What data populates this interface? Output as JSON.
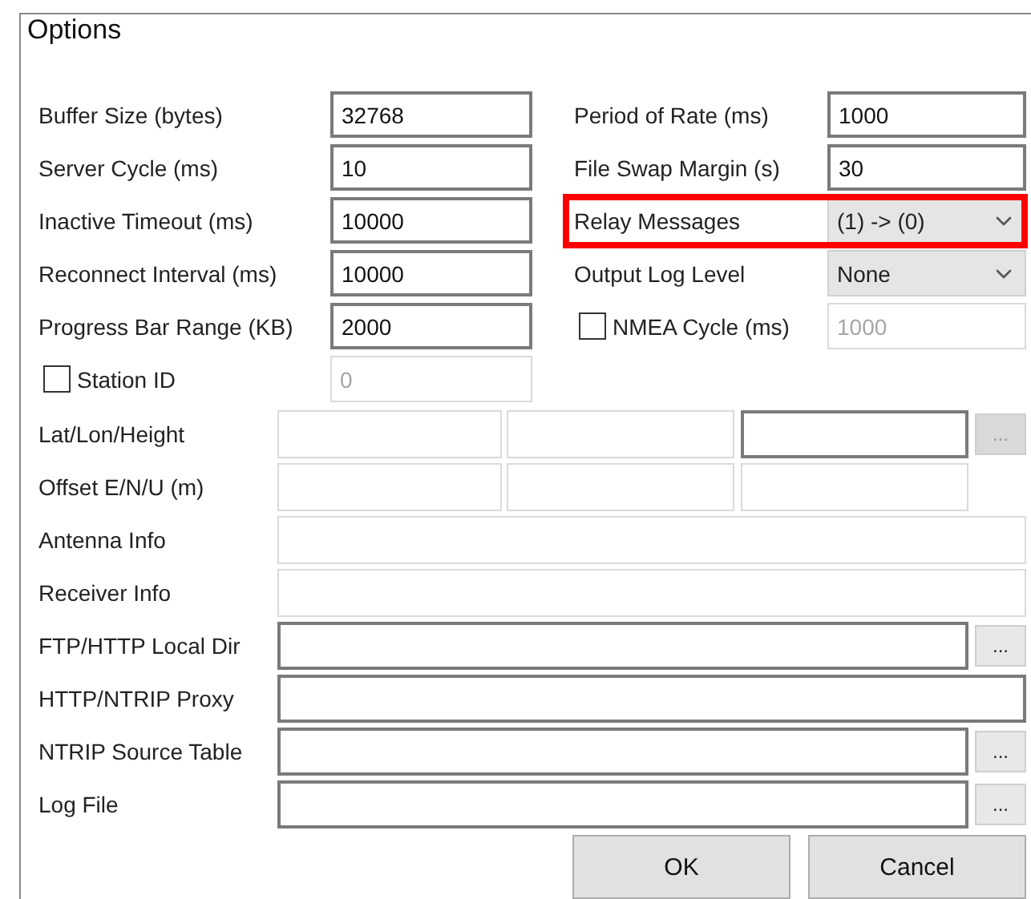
{
  "window": {
    "title": "Options"
  },
  "left_fields": [
    {
      "kind": "text",
      "label": "Buffer Size (bytes)",
      "value": "32768",
      "disabled": false
    },
    {
      "kind": "text",
      "label": "Server Cycle  (ms)",
      "value": "10",
      "disabled": false
    },
    {
      "kind": "text",
      "label": "Inactive Timeout (ms)",
      "value": "10000",
      "disabled": false
    },
    {
      "kind": "text",
      "label": "Reconnect Interval  (ms)",
      "value": "10000",
      "disabled": false
    },
    {
      "kind": "text",
      "label": "Progress Bar Range (KB)",
      "value": "2000",
      "disabled": false
    },
    {
      "kind": "checkbox",
      "label": "Station ID",
      "checked": false,
      "value": "0",
      "disabled": true
    }
  ],
  "right_fields": [
    {
      "kind": "text",
      "label": "Period of Rate (ms)",
      "value": "1000",
      "disabled": false,
      "highlighted": false
    },
    {
      "kind": "text",
      "label": "File Swap Margin (s)",
      "value": "30",
      "disabled": false,
      "highlighted": false
    },
    {
      "kind": "select",
      "label": "Relay Messages",
      "value": "(1)  -> (0)",
      "highlighted": true
    },
    {
      "kind": "select",
      "label": "Output Log Level",
      "value": "None",
      "highlighted": false
    },
    {
      "kind": "checkbox",
      "label": "NMEA Cycle (ms)",
      "checked": false,
      "value": "1000",
      "disabled": true,
      "highlighted": false
    }
  ],
  "lower_rows": [
    {
      "label": "Lat/Lon/Height",
      "fields": [
        {
          "disabled": true
        },
        {
          "disabled": true
        },
        {
          "disabled": false
        }
      ],
      "browse": {
        "label": "...",
        "disabled": true
      }
    },
    {
      "label": "Offset E/N/U (m)",
      "fields": [
        {
          "disabled": true
        },
        {
          "disabled": true
        },
        {
          "disabled": true
        }
      ]
    },
    {
      "label": "Antenna Info",
      "fields": [
        {
          "disabled": true
        }
      ]
    },
    {
      "label": "Receiver Info",
      "fields": [
        {
          "disabled": true
        }
      ]
    },
    {
      "label": "FTP/HTTP Local Dir",
      "fields": [
        {
          "disabled": false
        }
      ],
      "browse": {
        "label": "...",
        "disabled": false
      }
    },
    {
      "label": "HTTP/NTRIP Proxy",
      "fields": [
        {
          "disabled": false
        }
      ]
    },
    {
      "label": "NTRIP Source Table",
      "fields": [
        {
          "disabled": false
        }
      ],
      "browse": {
        "label": "...",
        "disabled": false
      }
    },
    {
      "label": "Log File",
      "fields": [
        {
          "disabled": false
        }
      ],
      "browse": {
        "label": "...",
        "disabled": false
      }
    }
  ],
  "buttons": [
    "OK",
    "Cancel"
  ]
}
